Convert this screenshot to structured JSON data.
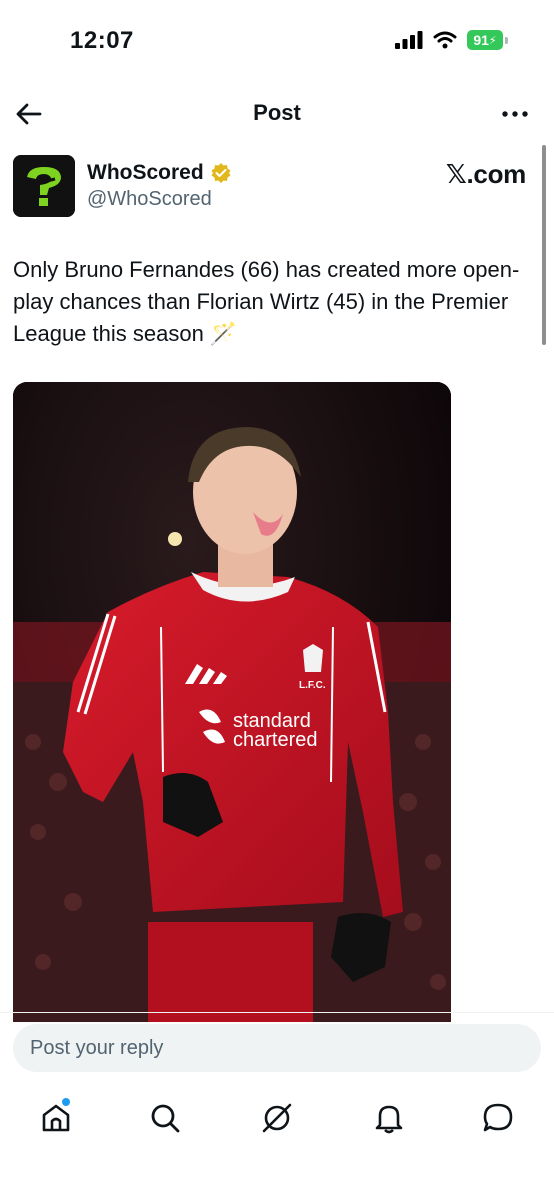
{
  "status": {
    "time": "12:07",
    "battery": "91"
  },
  "nav": {
    "title": "Post"
  },
  "post": {
    "author_name": "WhoScored",
    "author_handle": "@WhoScored",
    "source": "𝕏.com",
    "text": "Only Bruno Fernandes (66) has created more open-play chances than Florian Wirtz (45) in the Premier League this season 🪄",
    "jersey": {
      "sponsor_line1": "standard",
      "sponsor_line2": "chartered",
      "crest_label": "L.F.C."
    }
  },
  "reply": {
    "placeholder": "Post your reply"
  },
  "tabs": [
    {
      "name": "home",
      "icon": "home-icon"
    },
    {
      "name": "search",
      "icon": "search-icon"
    },
    {
      "name": "grok",
      "icon": "grok-icon"
    },
    {
      "name": "notifications",
      "icon": "bell-icon"
    },
    {
      "name": "messages",
      "icon": "chat-icon"
    }
  ],
  "colors": {
    "accent": "#1d9bf0",
    "verified": "#e2b719",
    "jersey": "#c8102e",
    "battery": "#34c759",
    "logo_green": "#7ed321"
  }
}
